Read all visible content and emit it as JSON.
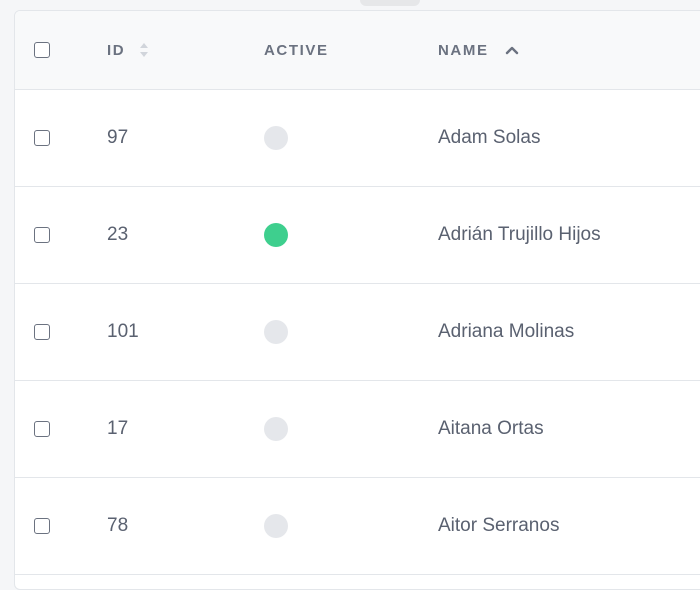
{
  "table": {
    "columns": {
      "id": "ID",
      "active": "ACTIVE",
      "name": "NAME"
    },
    "sort": {
      "column": "name",
      "direction": "ascending"
    },
    "colors": {
      "active_on": "#3ecf8e",
      "active_off": "#e5e7eb"
    },
    "rows": [
      {
        "id": "97",
        "active": false,
        "name": "Adam Solas"
      },
      {
        "id": "23",
        "active": true,
        "name": "Adrián Trujillo Hijos"
      },
      {
        "id": "101",
        "active": false,
        "name": "Adriana Molinas"
      },
      {
        "id": "17",
        "active": false,
        "name": "Aitana Ortas"
      },
      {
        "id": "78",
        "active": false,
        "name": "Aitor Serranos"
      }
    ]
  }
}
